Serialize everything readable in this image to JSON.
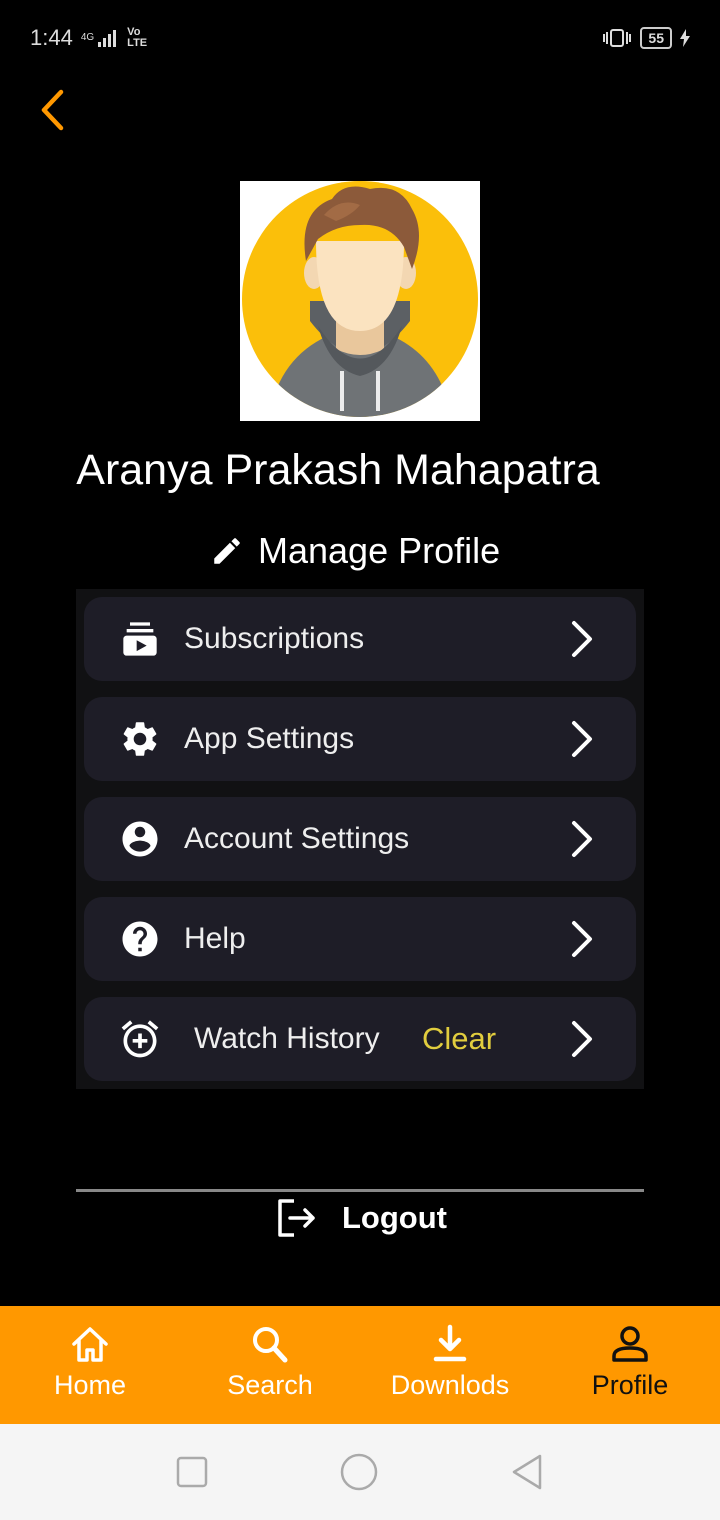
{
  "status_bar": {
    "time": "1:44",
    "network": "4G",
    "volte": "Vo LTE",
    "battery": "55"
  },
  "profile": {
    "name": "Aranya Prakash Mahapatra",
    "manage_label": "Manage Profile"
  },
  "menu": {
    "items": [
      {
        "label": "Subscriptions",
        "icon": "subscriptions-icon"
      },
      {
        "label": "App Settings",
        "icon": "gear-icon"
      },
      {
        "label": "Account Settings",
        "icon": "account-circle-icon"
      },
      {
        "label": "Help",
        "icon": "help-icon"
      },
      {
        "label": "Watch History",
        "icon": "alarm-add-icon",
        "action": "Clear"
      }
    ]
  },
  "logout_label": "Logout",
  "bottom_nav": {
    "items": [
      {
        "label": "Home",
        "icon": "home-icon"
      },
      {
        "label": "Search",
        "icon": "search-icon"
      },
      {
        "label": "Downlods",
        "icon": "download-icon"
      },
      {
        "label": "Profile",
        "icon": "person-icon",
        "active": true
      }
    ]
  },
  "colors": {
    "accent": "#ff9800",
    "card": "#1e1d27",
    "clear": "#e1cd3e"
  }
}
